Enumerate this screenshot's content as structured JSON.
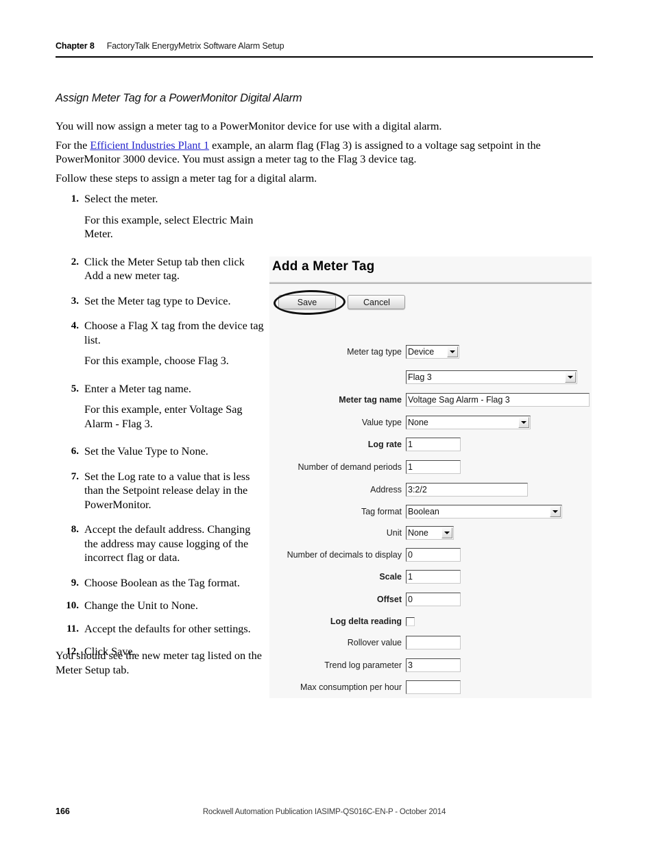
{
  "header": {
    "chapter_label": "Chapter 8",
    "chapter_title": "FactoryTalk EnergyMetrix Software Alarm Setup"
  },
  "section": {
    "heading": "Assign Meter Tag for a PowerMonitor Digital Alarm"
  },
  "paragraphs": {
    "intro_1": "You will now assign a meter tag to a PowerMonitor device for use with a digital alarm.",
    "intro_2_before": "For the ",
    "intro_2_link": "Efficient Industries Plant 1",
    "intro_2_after": " example, an alarm flag (Flag 3) is assigned to a voltage sag setpoint in the PowerMonitor 3000 device. You must assign a meter tag to the Flag 3 device tag.",
    "intro_3": "Follow these steps to assign a meter tag for a digital alarm.",
    "closing": "You should see the new meter tag listed on the Meter Setup tab."
  },
  "steps": [
    {
      "num": "1.",
      "text": "Select the meter.",
      "sub": "For this example, select Electric Main Meter."
    },
    {
      "num": "2.",
      "text": "Click the Meter Setup tab then click Add a new meter tag.",
      "sub": ""
    },
    {
      "num": "3.",
      "text": "Set the Meter tag type to Device.",
      "sub": ""
    },
    {
      "num": "4.",
      "text": "Choose a Flag X tag from the device tag list.",
      "sub": "For this example, choose Flag 3."
    },
    {
      "num": "5.",
      "text": "Enter a Meter tag name.",
      "sub": "For this example, enter Voltage Sag Alarm - Flag 3."
    },
    {
      "num": "6.",
      "text": "Set the Value Type to None.",
      "sub": ""
    },
    {
      "num": "7.",
      "text": "Set the Log rate to a value that is less than the Setpoint release delay in the PowerMonitor.",
      "sub": ""
    },
    {
      "num": "8.",
      "text": "Accept the default address. Changing the address may cause logging of the incorrect flag or data.",
      "sub": ""
    },
    {
      "num": "9.",
      "text": "Choose Boolean as the Tag format.",
      "sub": ""
    },
    {
      "num": "10.",
      "text": "Change the Unit to None.",
      "sub": ""
    },
    {
      "num": "11.",
      "text": "Accept the defaults for other settings.",
      "sub": ""
    },
    {
      "num": "12.",
      "text": "Click Save.",
      "sub": ""
    }
  ],
  "app": {
    "title": "Add a Meter Tag",
    "save_label": "Save",
    "cancel_label": "Cancel",
    "fields": {
      "meter_tag_type": {
        "label": "Meter tag type",
        "value": "Device"
      },
      "device_tag": {
        "label": "",
        "value": "Flag 3"
      },
      "meter_tag_name": {
        "label": "Meter tag name",
        "value": "Voltage Sag Alarm - Flag 3"
      },
      "value_type": {
        "label": "Value type",
        "value": "None"
      },
      "log_rate": {
        "label": "Log rate",
        "value": "1"
      },
      "demand_periods": {
        "label": "Number of demand periods",
        "value": "1"
      },
      "address": {
        "label": "Address",
        "value": "3:2/2"
      },
      "tag_format": {
        "label": "Tag format",
        "value": "Boolean"
      },
      "unit": {
        "label": "Unit",
        "value": "None"
      },
      "decimals": {
        "label": "Number of decimals to display",
        "value": "0"
      },
      "scale": {
        "label": "Scale",
        "value": "1"
      },
      "offset": {
        "label": "Offset",
        "value": "0"
      },
      "log_delta_reading": {
        "label": "Log delta reading",
        "value": ""
      },
      "rollover_value": {
        "label": "Rollover value",
        "value": ""
      },
      "trend_log_parameter": {
        "label": "Trend log parameter",
        "value": "3"
      },
      "max_consumption": {
        "label": "Max consumption per hour",
        "value": ""
      }
    }
  },
  "footer": {
    "page_number": "166",
    "publication": "Rockwell Automation Publication IASIMP-QS016C-EN-P - October 2014"
  },
  "colors": {
    "link": "#2222cc",
    "rule": "#000000",
    "panel_bg": "#f7f7f7"
  }
}
